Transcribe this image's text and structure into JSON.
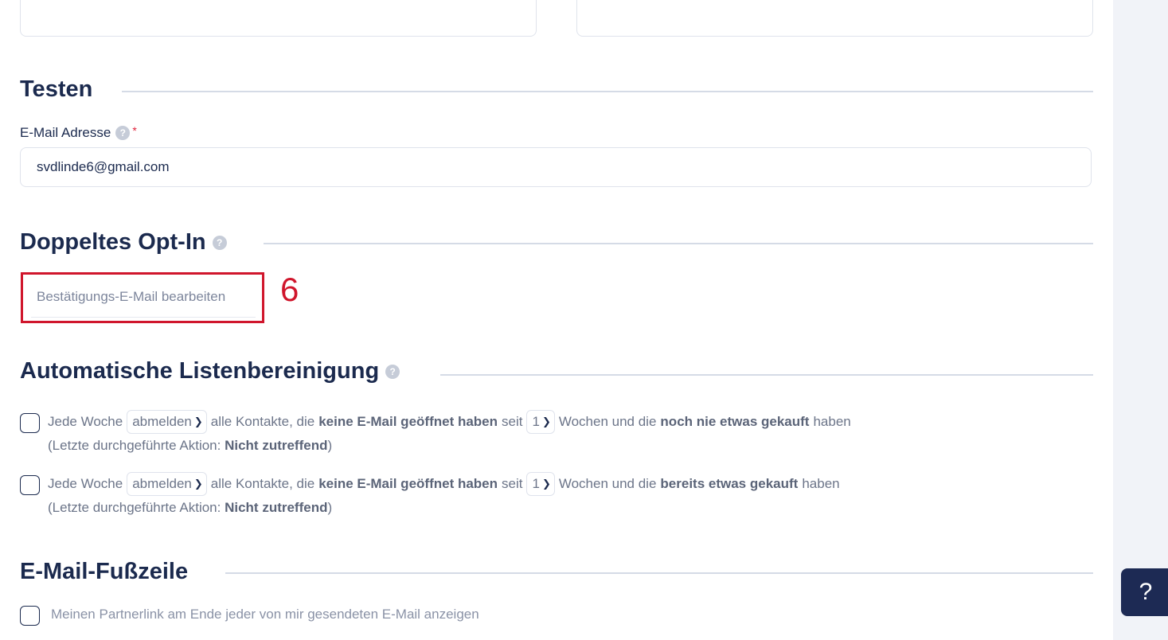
{
  "testen": {
    "title": "Testen",
    "email_label": "E-Mail Adresse",
    "help_glyph": "?",
    "required_mark": "*",
    "email_value": "svdlinde6@gmail.com"
  },
  "double_opt_in": {
    "title": "Doppeltes Opt-In",
    "help_glyph": "?",
    "edit_button_label": "Bestätigungs-E-Mail bearbeiten",
    "annotation_number": "6"
  },
  "auto_cleanup": {
    "title": "Automatische Listenbereinigung",
    "help_glyph": "?",
    "rules": [
      {
        "prefix": "Jede Woche",
        "action_value": "abmelden",
        "middle": "alle Kontakte, die",
        "bold1": "keine E-Mail geöffnet haben",
        "seit": "seit",
        "weeks_value": "1",
        "after_weeks": "Wochen und die",
        "bold2": "noch nie etwas gekauft",
        "suffix": "haben",
        "last_action_prefix": "(Letzte durchgeführte Aktion: ",
        "last_action_value": "Nicht zutreffend",
        "last_action_suffix": ")"
      },
      {
        "prefix": "Jede Woche",
        "action_value": "abmelden",
        "middle": "alle Kontakte, die",
        "bold1": "keine E-Mail geöffnet haben",
        "seit": "seit",
        "weeks_value": "1",
        "after_weeks": "Wochen und die",
        "bold2": "bereits etwas gekauft",
        "suffix": "haben",
        "last_action_prefix": "(Letzte durchgeführte Aktion: ",
        "last_action_value": "Nicht zutreffend",
        "last_action_suffix": ")"
      }
    ]
  },
  "footer": {
    "title": "E-Mail-Fußzeile",
    "partner_link_label": "Meinen Partnerlink am Ende jeder von mir gesendeten E-Mail anzeigen"
  },
  "help_button": {
    "glyph": "?"
  },
  "colors": {
    "heading": "#1b2a4e",
    "annotation": "#d0162c",
    "help_button_bg": "#1d2a54"
  }
}
